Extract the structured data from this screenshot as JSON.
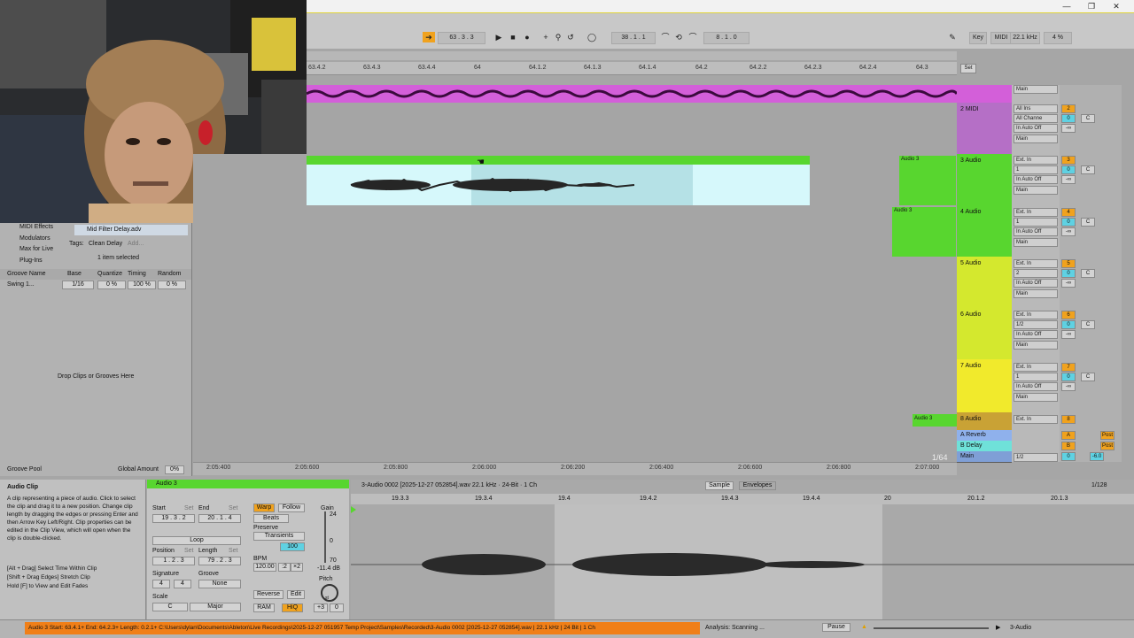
{
  "transport": {
    "position": "63 .  3 .  3",
    "loop_start": "38 .  1 .  1",
    "loop_length": "8 .  1 .  0",
    "key_label": "Key",
    "midi_label": "MIDI",
    "sample_rate": "22.1 kHz",
    "cpu": "4 %"
  },
  "ruler": [
    "63.4.2",
    "63.4.3",
    "63.4.4",
    "64",
    "64.1.2",
    "64.1.3",
    "64.1.4",
    "64.2",
    "64.2.2",
    "64.2.3",
    "64.2.4",
    "64.3"
  ],
  "time_ruler": [
    "2:05:400",
    "2:05:600",
    "2:05:800",
    "2:06:000",
    "2:06:200",
    "2:06:400",
    "2:06:600",
    "2:06:800",
    "2:07:000"
  ],
  "zoom_label": "1/64",
  "set_button": "Set",
  "tracks": [
    {
      "name": "",
      "input": "Main",
      "number": "",
      "color": "#d35fd9"
    },
    {
      "name": "2 MIDI",
      "input": "All Ins",
      "channel": "All Channe",
      "monitor": [
        "In",
        "Auto",
        "Off"
      ],
      "output": "Main",
      "number": "2",
      "send_a": "0",
      "send_b": "C",
      "vol": "-∞",
      "color": "#b56fc6"
    },
    {
      "name": "3 Audio",
      "input": "Ext. In",
      "channel": "1",
      "monitor": [
        "In",
        "Auto",
        "Off"
      ],
      "output": "Main",
      "number": "3",
      "send_a": "0",
      "send_b": "C",
      "vol": "-∞",
      "color": "#58d62f"
    },
    {
      "name": "4 Audio",
      "input": "Ext. In",
      "channel": "1",
      "monitor": [
        "In",
        "Auto",
        "Off"
      ],
      "output": "Main",
      "number": "4",
      "send_a": "0",
      "send_b": "C",
      "vol": "-∞",
      "color": "#58d62f"
    },
    {
      "name": "5 Audio",
      "input": "Ext. In",
      "channel": "2",
      "monitor": [
        "In",
        "Auto",
        "Off"
      ],
      "output": "Main",
      "number": "5",
      "send_a": "0",
      "send_b": "C",
      "vol": "-∞",
      "color": "#d4e82e"
    },
    {
      "name": "6 Audio",
      "input": "Ext. In",
      "channel": "1/2",
      "monitor": [
        "In",
        "Auto",
        "Off"
      ],
      "output": "Main",
      "number": "6",
      "send_a": "0",
      "send_b": "C",
      "vol": "-∞",
      "color": "#d4e82e"
    },
    {
      "name": "7 Audio",
      "input": "Ext. In",
      "channel": "1",
      "monitor": [
        "In",
        "Auto",
        "Off"
      ],
      "output": "Main",
      "number": "7",
      "send_a": "0",
      "send_b": "C",
      "vol": "-∞",
      "color": "#f1ea2c"
    },
    {
      "name": "8 Audio",
      "input": "Ext. In",
      "number": "8",
      "color": "#c9a235"
    }
  ],
  "returns": [
    {
      "name": "A Reverb",
      "letter": "A",
      "mode": "Post",
      "color": "#8fb1ec"
    },
    {
      "name": "B Delay",
      "letter": "B",
      "mode": "Post",
      "color": "#6fe1d9"
    }
  ],
  "main_track": {
    "name": "Main",
    "channel": "1/2",
    "number": "0",
    "vol": "-6.0"
  },
  "clips": {
    "audio3": "Audio 3"
  },
  "browser": {
    "categories": [
      "MIDI Effects",
      "Modulators",
      "Max for Live",
      "Plug-Ins"
    ],
    "file": "Mid Filter Delay.adv",
    "tags_label": "Tags:",
    "tag": "Clean Delay",
    "tag_add": "Add...",
    "selected": "1 item selected",
    "groove_headers": [
      "Groove Name",
      "Base",
      "Quantize",
      "Timing",
      "Random"
    ],
    "groove_row": {
      "name": "Swing 1...",
      "base": "1/16",
      "quantize": "0 %",
      "timing": "100 %",
      "random": "0 %"
    },
    "drop_hint": "Drop Clips or Grooves Here",
    "groove_pool": "Groove Pool",
    "global_amount_label": "Global Amount",
    "global_amount": "0%"
  },
  "info": {
    "title": "Audio Clip",
    "body": "A clip representing a piece of audio. Click to select the clip and drag it to a new position. Change clip length by dragging the edges or pressing Enter and then Arrow Key Left/Right. Clip properties can be edited in the Clip View, which will open when the clip is double-clicked.",
    "hints": "[Alt + Drag] Select Time Within Clip\n[Shift + Drag Edges] Stretch Clip\nHold [F] to View and Edit Fades"
  },
  "clip": {
    "name": "Audio 3",
    "start_label": "Start",
    "set": "Set",
    "end_label": "End",
    "start": "19 .  3 .  2",
    "end": "20 .  1 .  4",
    "loop": "Loop",
    "position_label": "Position",
    "length_label": "Length",
    "position": "1 .  2 .  3",
    "length": "79 .  2 .  3",
    "signature_label": "Signature",
    "sig_num": "4",
    "sig_den": "4",
    "groove_label": "Groove",
    "groove": "None",
    "scale_label": "Scale",
    "scale_root": "C",
    "scale_mode": "Major",
    "warp": "Warp",
    "follow": "Follow",
    "beats": "Beats",
    "preserve_label": "Preserve",
    "transients": "Transients",
    "transient_val": "100",
    "bpm_label": "BPM",
    "bpm": "120.00",
    "half": ":2",
    "double": "×2",
    "reverse": "Reverse",
    "edit": "Edit",
    "ram": "RAM",
    "hiq": "HiQ",
    "gain_label": "Gain",
    "gain": "-11.4 dB",
    "gain_top": "24",
    "gain_mid": "0",
    "gain_bot": "70",
    "pitch_label": "Pitch",
    "pitch": "+3",
    "detune": "0",
    "st": "st"
  },
  "sample": {
    "file": "3-Audio 0002 [2025-12-27 052854].wav   22.1 kHz · 24-Bit · 1 Ch",
    "tab_sample": "Sample",
    "tab_envelopes": "Envelopes",
    "grid": "1/128",
    "ruler": [
      "19.3.3",
      "19.3.4",
      "19.4",
      "19.4.2",
      "19.4.3",
      "19.4.4",
      "20",
      "20.1.2",
      "20.1.3"
    ]
  },
  "status": {
    "message": "Audio 3  Start: 63.4.1+  End: 64.2.3+  Length: 0.2.1+  C:\\Users\\dylan\\Documents\\Ableton\\Live Recordings\\2025-12-27 051957 Temp Project\\Samples\\Recorded\\3-Audio 0002 [2025-12-27 052854].wav | 22.1 kHz | 24 Bit | 1 Ch",
    "analysis": "Analysis: Scanning ...",
    "pause": "Pause",
    "track": "3-Audio"
  },
  "colors": {
    "accent": "#f0a21e",
    "green": "#58d62f",
    "cyan": "#d6f8fb",
    "pink": "#d35fd9",
    "status_orange": "#f07f18"
  }
}
